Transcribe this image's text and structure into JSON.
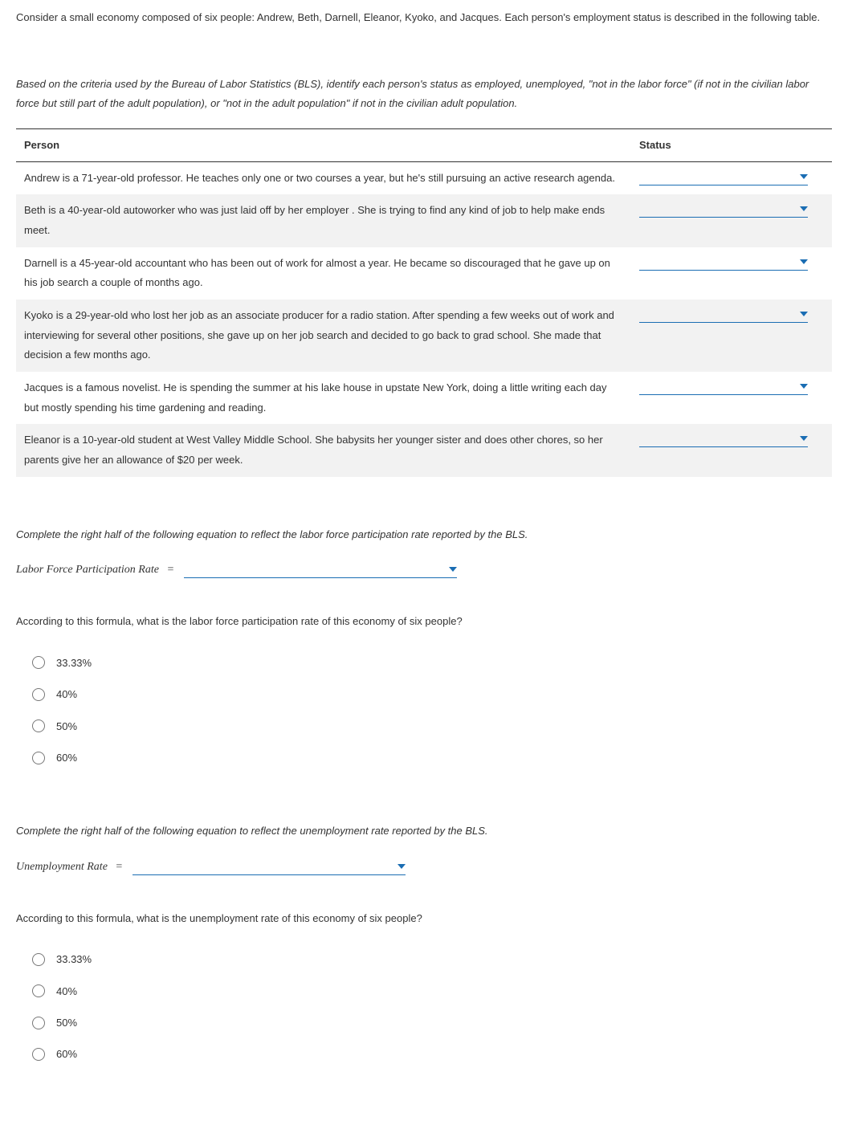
{
  "intro": "Consider a small economy composed of six people: Andrew, Beth, Darnell, Eleanor, Kyoko, and Jacques. Each person's employment status is described in the following table.",
  "instructions": "Based on the criteria used by the Bureau of Labor Statistics (BLS), identify each person's status as employed, unemployed, \"not in the labor force\" (if not in the civilian labor force but still part of the adult population), or \"not in the adult population\" if not in the civilian adult population.",
  "table": {
    "headers": {
      "person": "Person",
      "status": "Status"
    },
    "rows": [
      {
        "text": "Andrew is a 71-year-old professor. He teaches only one or two courses a year, but he's still pursuing an active research agenda."
      },
      {
        "text": "Beth is a 40-year-old autoworker who was just laid off by her employer . She is trying to find any kind of job to help make ends meet."
      },
      {
        "text": "Darnell is a 45-year-old accountant who has been out of work for almost a year. He became so discouraged that he gave up on his job search a couple of months ago."
      },
      {
        "text": "Kyoko is a 29-year-old who lost her job as an associate producer for a radio station. After spending a few weeks out of work and interviewing for several other positions, she gave up on her job search and decided to go back to grad school. She made that decision a few months ago."
      },
      {
        "text": "Jacques is a famous novelist. He is spending the summer at his lake house in upstate New York, doing a little writing each day but mostly spending his time gardening and reading."
      },
      {
        "text": "Eleanor is a 10-year-old student at West Valley Middle School. She babysits her younger sister and does other chores, so her parents give her an allowance of $20 per week."
      }
    ]
  },
  "lfpr": {
    "prompt": "Complete the right half of the following equation to reflect the labor force participation rate reported by the BLS.",
    "label": "Labor Force Participation Rate",
    "equals": "=",
    "question": "According to this formula, what is the labor force participation rate of this economy of six people?",
    "options": [
      "33.33%",
      "40%",
      "50%",
      "60%"
    ]
  },
  "unemp": {
    "prompt": "Complete the right half of the following equation to reflect the unemployment rate reported by the BLS.",
    "label": "Unemployment Rate",
    "equals": "=",
    "question": "According to this formula, what is the unemployment rate of this economy of six people?",
    "options": [
      "33.33%",
      "40%",
      "50%",
      "60%"
    ]
  }
}
